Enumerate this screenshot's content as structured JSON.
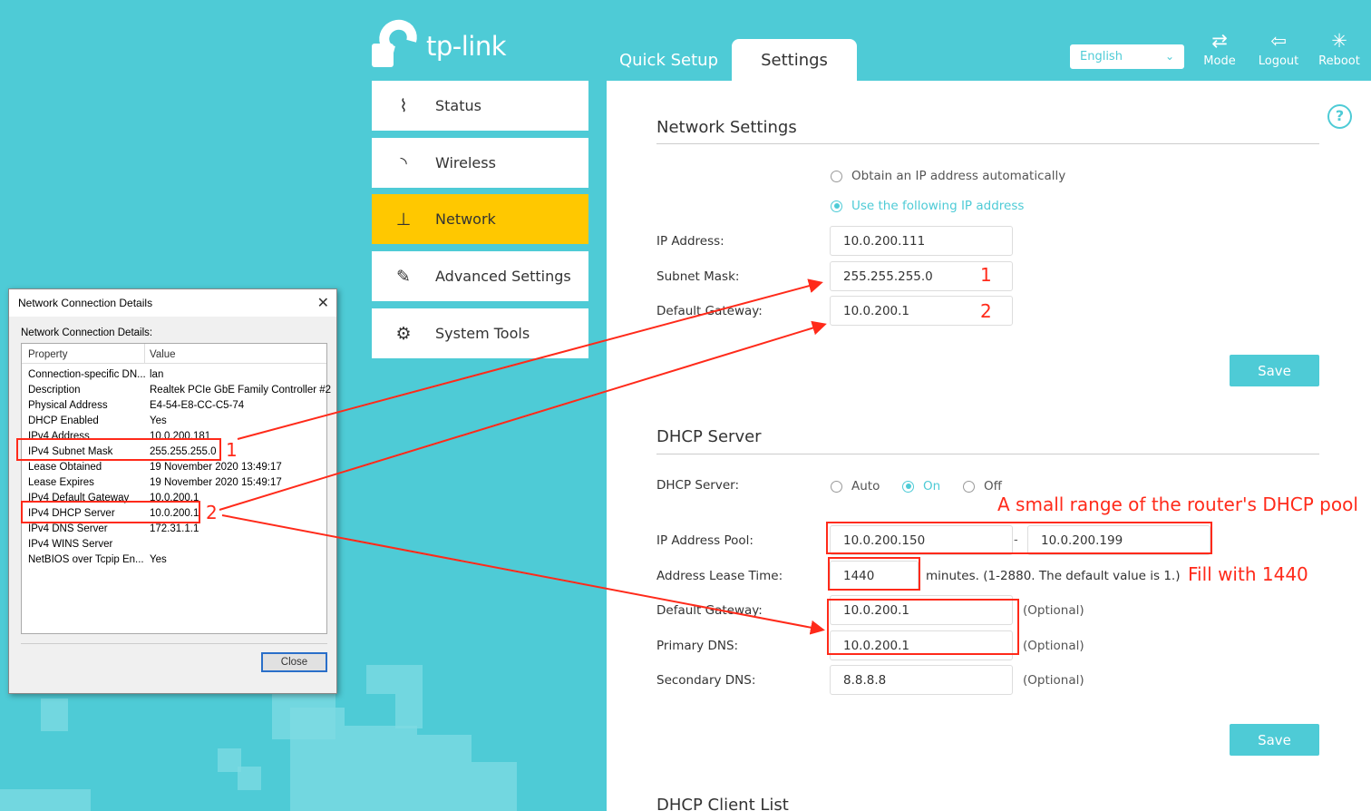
{
  "header": {
    "logo_text": "tp-link",
    "tabs": [
      "Quick Setup",
      "Settings"
    ],
    "language": "English",
    "buttons": {
      "mode": "Mode",
      "logout": "Logout",
      "reboot": "Reboot"
    }
  },
  "sidebar": {
    "items": [
      {
        "label": "Status",
        "icon": "pulse-icon"
      },
      {
        "label": "Wireless",
        "icon": "wireless-icon"
      },
      {
        "label": "Network",
        "icon": "network-icon"
      },
      {
        "label": "Advanced Settings",
        "icon": "wrench-icon"
      },
      {
        "label": "System Tools",
        "icon": "gear-icon"
      }
    ],
    "active": "Network"
  },
  "network_settings": {
    "title": "Network Settings",
    "radio_auto": "Obtain an IP address automatically",
    "radio_manual": "Use the following IP address",
    "ip_label": "IP Address:",
    "ip_value": "10.0.200.111",
    "mask_label": "Subnet Mask:",
    "mask_value": "255.255.255.0",
    "gateway_label": "Default Gateway:",
    "gateway_value": "10.0.200.1",
    "save": "Save"
  },
  "dhcp_server": {
    "title": "DHCP Server",
    "server_label": "DHCP Server:",
    "options": [
      "Auto",
      "On",
      "Off"
    ],
    "selected": "On",
    "pool_label": "IP Address Pool:",
    "pool_start": "10.0.200.150",
    "pool_dash": "-",
    "pool_end": "10.0.200.199",
    "lease_label": "Address Lease Time:",
    "lease_value": "1440",
    "lease_note": "minutes. (1-2880. The default value is 1.)",
    "gateway_label": "Default Gateway:",
    "gateway_value": "10.0.200.1",
    "primary_dns_label": "Primary DNS:",
    "primary_dns_value": "10.0.200.1",
    "secondary_dns_label": "Secondary DNS:",
    "secondary_dns_value": "8.8.8.8",
    "optional": "(Optional)",
    "save": "Save"
  },
  "client_list": {
    "title": "DHCP Client List"
  },
  "annotations": {
    "num1": "1",
    "num2": "2",
    "pool_note": "A small range of the router's DHCP pool",
    "lease_note": "Fill with 1440",
    "color": "#ff2a1a"
  },
  "dialog": {
    "title": "Network Connection Details",
    "subtitle": "Network Connection Details:",
    "col_property": "Property",
    "col_value": "Value",
    "rows": [
      {
        "k": "Connection-specific DN...",
        "v": "lan"
      },
      {
        "k": "Description",
        "v": "Realtek PCIe GbE Family Controller #2"
      },
      {
        "k": "Physical Address",
        "v": "E4-54-E8-CC-C5-74"
      },
      {
        "k": "DHCP Enabled",
        "v": "Yes"
      },
      {
        "k": "IPv4 Address",
        "v": "10.0.200.181"
      },
      {
        "k": "IPv4 Subnet Mask",
        "v": "255.255.255.0"
      },
      {
        "k": "Lease Obtained",
        "v": "19 November 2020 13:49:17"
      },
      {
        "k": "Lease Expires",
        "v": "19 November 2020 15:49:17"
      },
      {
        "k": "IPv4 Default Gateway",
        "v": "10.0.200.1"
      },
      {
        "k": "IPv4 DHCP Server",
        "v": "10.0.200.1"
      },
      {
        "k": "IPv4 DNS Server",
        "v": "172.31.1.1"
      },
      {
        "k": "IPv4 WINS Server",
        "v": ""
      },
      {
        "k": "NetBIOS over Tcpip En...",
        "v": "Yes"
      }
    ],
    "close": "Close"
  },
  "colors": {
    "accent": "#4ecbd6",
    "active_nav": "#ffc800"
  }
}
